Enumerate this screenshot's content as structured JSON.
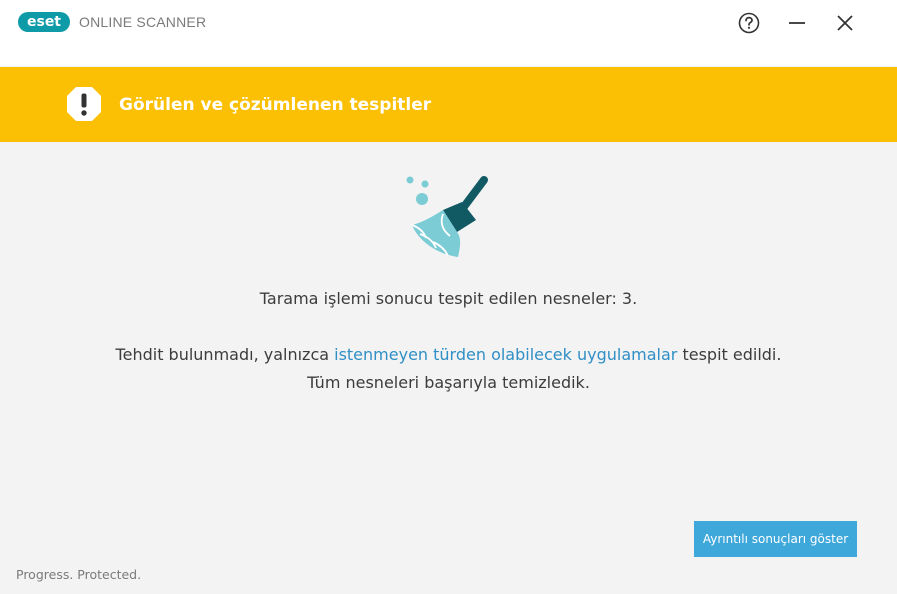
{
  "titlebar": {
    "logo_text": "eset",
    "product_name": "ONLINE SCANNER",
    "buttons": {
      "help_icon": "question-circle-icon",
      "minimize_icon": "minimize-icon",
      "close_icon": "close-icon"
    }
  },
  "banner": {
    "icon": "exclamation-icon",
    "title": "Görülen ve çözümlenen tespitler",
    "color": "#fbc004"
  },
  "content": {
    "illustration_icon": "broom-icon",
    "line1": "Tarama işlemi sonucu tespit edilen nesneler: 3.",
    "line2_prefix": "Tehdit bulunmadı, yalnızca ",
    "line2_link": "istenmeyen türden olabilecek uygulamalar",
    "line2_suffix": " tespit edildi.",
    "line3": "Tüm nesneleri başarıyla temizledik."
  },
  "actions": {
    "show_details_label": "Ayrıntılı sonuçları göster"
  },
  "footer": {
    "slogan": "Progress. Protected."
  },
  "colors": {
    "accent": "#3fa8db",
    "link": "#2f8fc6",
    "brand": "#0e9aa7"
  }
}
